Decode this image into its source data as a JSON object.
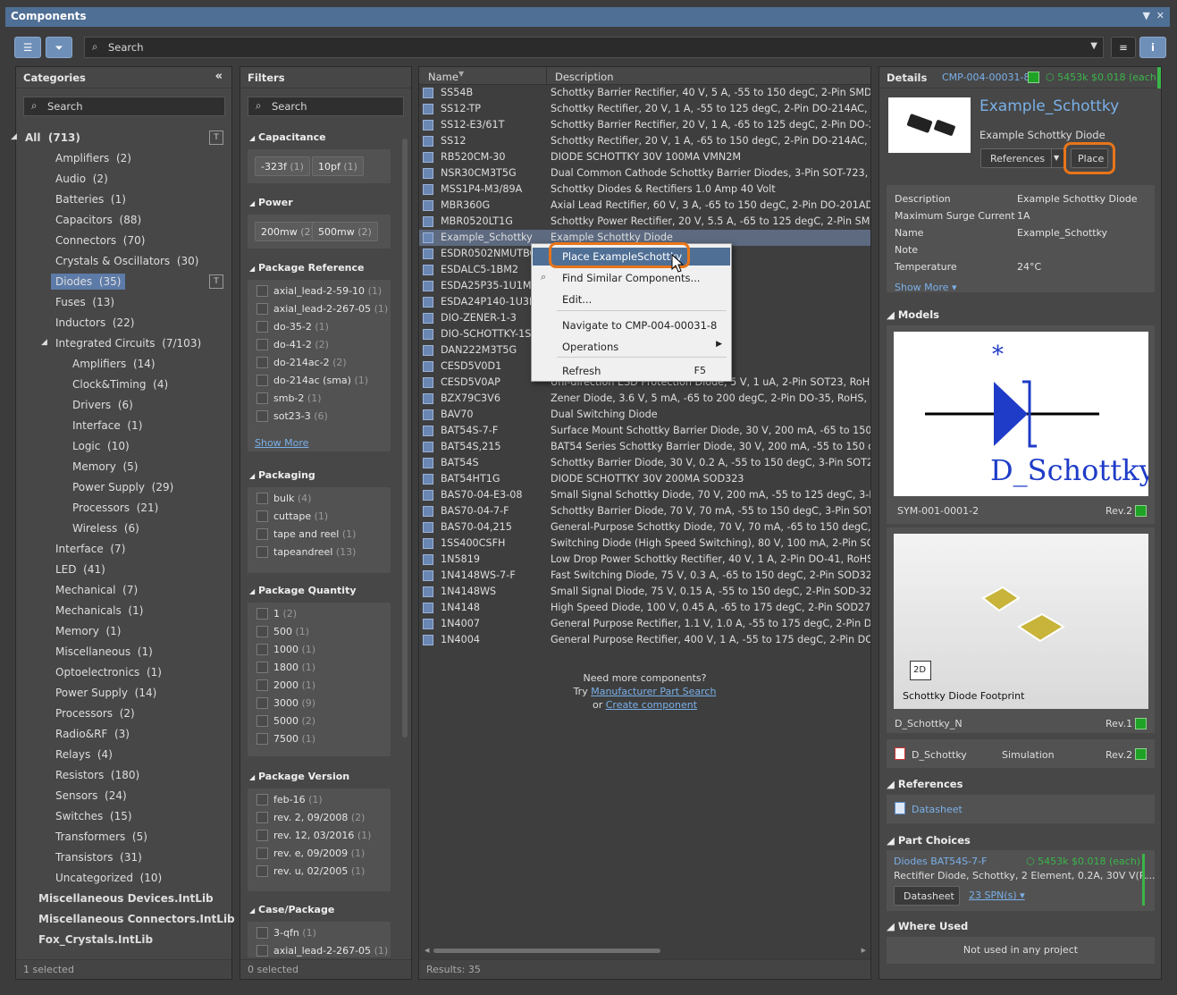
{
  "window": {
    "title": "Components"
  },
  "toolbar": {
    "search_placeholder": "Search"
  },
  "categories": {
    "header": "Categories",
    "search": "Search",
    "footer": "1 selected",
    "items": [
      {
        "label": "All",
        "count": "(713)",
        "level": 0,
        "expanded": true,
        "filter_icon": true
      },
      {
        "label": "Amplifiers",
        "count": "(2)",
        "level": 1
      },
      {
        "label": "Audio",
        "count": "(2)",
        "level": 1
      },
      {
        "label": "Batteries",
        "count": "(1)",
        "level": 1
      },
      {
        "label": "Capacitors",
        "count": "(88)",
        "level": 1
      },
      {
        "label": "Connectors",
        "count": "(70)",
        "level": 1
      },
      {
        "label": "Crystals & Oscillators",
        "count": "(30)",
        "level": 1
      },
      {
        "label": "Diodes",
        "count": "(35)",
        "level": 1,
        "selected": true,
        "filter_icon": true
      },
      {
        "label": "Fuses",
        "count": "(13)",
        "level": 1
      },
      {
        "label": "Inductors",
        "count": "(22)",
        "level": 1
      },
      {
        "label": "Integrated Circuits",
        "count": "(7/103)",
        "level": 1,
        "expanded": true
      },
      {
        "label": "Amplifiers",
        "count": "(14)",
        "level": 2
      },
      {
        "label": "Clock&Timing",
        "count": "(4)",
        "level": 2
      },
      {
        "label": "Drivers",
        "count": "(6)",
        "level": 2
      },
      {
        "label": "Interface",
        "count": "(1)",
        "level": 2
      },
      {
        "label": "Logic",
        "count": "(10)",
        "level": 2
      },
      {
        "label": "Memory",
        "count": "(5)",
        "level": 2
      },
      {
        "label": "Power Supply",
        "count": "(29)",
        "level": 2
      },
      {
        "label": "Processors",
        "count": "(21)",
        "level": 2
      },
      {
        "label": "Wireless",
        "count": "(6)",
        "level": 2
      },
      {
        "label": "Interface",
        "count": "(7)",
        "level": 1
      },
      {
        "label": "LED",
        "count": "(41)",
        "level": 1
      },
      {
        "label": "Mechanical",
        "count": "(7)",
        "level": 1
      },
      {
        "label": "Mechanicals",
        "count": "(1)",
        "level": 1
      },
      {
        "label": "Memory",
        "count": "(1)",
        "level": 1
      },
      {
        "label": "Miscellaneous",
        "count": "(1)",
        "level": 1
      },
      {
        "label": "Optoelectronics",
        "count": "(1)",
        "level": 1
      },
      {
        "label": "Power Supply",
        "count": "(14)",
        "level": 1
      },
      {
        "label": "Processors",
        "count": "(2)",
        "level": 1
      },
      {
        "label": "Radio&RF",
        "count": "(3)",
        "level": 1
      },
      {
        "label": "Relays",
        "count": "(4)",
        "level": 1
      },
      {
        "label": "Resistors",
        "count": "(180)",
        "level": 1
      },
      {
        "label": "Sensors",
        "count": "(24)",
        "level": 1
      },
      {
        "label": "Switches",
        "count": "(15)",
        "level": 1
      },
      {
        "label": "Transformers",
        "count": "(5)",
        "level": 1
      },
      {
        "label": "Transistors",
        "count": "(31)",
        "level": 1
      },
      {
        "label": "Uncategorized",
        "count": "(10)",
        "level": 1
      }
    ],
    "libs": [
      "Miscellaneous Devices.IntLib",
      "Miscellaneous Connectors.IntLib",
      "Fox_Crystals.IntLib"
    ]
  },
  "filters": {
    "header": "Filters",
    "search": "Search",
    "footer": "0 selected",
    "show_more": "Show More",
    "capacitance": {
      "title": "Capacitance",
      "chips": [
        {
          "label": "-323f",
          "count": "(1)"
        },
        {
          "label": "10pf",
          "count": "(1)"
        }
      ]
    },
    "power": {
      "title": "Power",
      "chips": [
        {
          "label": "200mw",
          "count": "(2)"
        },
        {
          "label": "500mw",
          "count": "(2)"
        }
      ]
    },
    "package_reference": {
      "title": "Package Reference",
      "items": [
        {
          "label": "axial_lead-2-59-10",
          "count": "(1)"
        },
        {
          "label": "axial_lead-2-267-05",
          "count": "(1)"
        },
        {
          "label": "do-35-2",
          "count": "(1)"
        },
        {
          "label": "do-41-2",
          "count": "(2)"
        },
        {
          "label": "do-214ac-2",
          "count": "(2)"
        },
        {
          "label": "do-214ac (sma)",
          "count": "(1)"
        },
        {
          "label": "smb-2",
          "count": "(1)"
        },
        {
          "label": "sot23-3",
          "count": "(6)"
        }
      ]
    },
    "packaging": {
      "title": "Packaging",
      "items": [
        {
          "label": "bulk",
          "count": "(4)"
        },
        {
          "label": "cuttape",
          "count": "(1)"
        },
        {
          "label": "tape and reel",
          "count": "(1)"
        },
        {
          "label": "tapeandreel",
          "count": "(13)"
        }
      ]
    },
    "package_quantity": {
      "title": "Package Quantity",
      "items": [
        {
          "label": "1",
          "count": "(2)"
        },
        {
          "label": "500",
          "count": "(1)"
        },
        {
          "label": "1000",
          "count": "(1)"
        },
        {
          "label": "1800",
          "count": "(1)"
        },
        {
          "label": "2000",
          "count": "(1)"
        },
        {
          "label": "3000",
          "count": "(9)"
        },
        {
          "label": "5000",
          "count": "(2)"
        },
        {
          "label": "7500",
          "count": "(1)"
        }
      ]
    },
    "package_version": {
      "title": "Package Version",
      "items": [
        {
          "label": "feb-16",
          "count": "(1)"
        },
        {
          "label": "rev. 2, 09/2008",
          "count": "(2)"
        },
        {
          "label": "rev. 12, 03/2016",
          "count": "(1)"
        },
        {
          "label": "rev. e, 09/2009",
          "count": "(1)"
        },
        {
          "label": "rev. u, 02/2005",
          "count": "(1)"
        }
      ]
    },
    "case_package": {
      "title": "Case/Package",
      "items": [
        {
          "label": "3-qfn",
          "count": "(1)"
        },
        {
          "label": "axial_lead-2-267-05",
          "count": "(1)"
        }
      ]
    }
  },
  "list": {
    "col_name": "Name",
    "col_desc": "Description",
    "footer": "Results: 35",
    "need_more": "Need more components?",
    "try": "Try",
    "mps": "Manufacturer Part Search",
    "or": "or",
    "create": "Create component",
    "rows": [
      [
        "SS54B",
        "Schottky Barrier Rectifier, 40 V, 5 A, -55 to 150 degC, 2-Pin SMD"
      ],
      [
        "SS12-TP",
        "Schottky Rectifier, 20 V, 1 A, -55 to 125 degC, 2-Pin DO-214AC, RoHS, T"
      ],
      [
        "SS12-E3/61T",
        "Schottky Barrier Rectifier, 20 V, 1 A, -65 to 125 degC, 2-Pin DO-214AC ("
      ],
      [
        "SS12",
        "Schottky Rectifier, 20 V, 1 A, -65 to 150 degC, 2-Pin DO-214AC, RoHS, T"
      ],
      [
        "RB520CM-30",
        "DIODE SCHOTTKY 30V 100MA VMN2M"
      ],
      [
        "NSR30CM3T5G",
        "Dual Common Cathode Schottky Barrier Diodes, 3-Pin SOT-723, Pb-Fre"
      ],
      [
        "MSS1P4-M3/89A",
        "Schottky Diodes & Rectifiers 1.0 Amp 40 Volt"
      ],
      [
        "MBR360G",
        "Axial Lead Rectifier, 60 V, 3 A, -65 to 150 degC, 2-Pin DO-201AD, RoHS,"
      ],
      [
        "MBR0520LT1G",
        "Schottky Power Rectifier, 20 V, 5.5 A, -65 to 125 degC, 2-Pin SMD, RoH"
      ],
      [
        "Example_Schottky",
        "Example Schottky Diode"
      ],
      [
        "ESDR0502NMUTBG",
        "                                        Array for High Speed Data Line"
      ],
      [
        "ESDALC5-1BM2",
        "                                          V, -55 to 150 degC, 2-Pin SOD"
      ],
      [
        "ESDA25P35-1U1M",
        ""
      ],
      [
        "ESDA24P140-1U3M",
        "                                          clamp"
      ],
      [
        "DIO-ZENER-1-3",
        ""
      ],
      [
        "DIO-SCHOTTKY-1S",
        ""
      ],
      [
        "DAN222M3T5G",
        "                                         ng Diodes, 3-Pin SOT-723, Pb-F"
      ],
      [
        "CESD5V0D1",
        "                                         1 uA, 2-Pin SOD-123, RoHS, T"
      ],
      [
        "CESD5V0AP",
        "Uni-direction ESD Protection Diode, 5 V, 1 uA, 2-Pin SOT23, RoHS, Ta"
      ],
      [
        "BZX79C3V6",
        "Zener Diode, 3.6 V, 5 mA, -65 to 200 degC, 2-Pin DO-35, RoHS, Bulk"
      ],
      [
        "BAV70",
        "Dual Switching Diode"
      ],
      [
        "BAT54S-7-F",
        "Surface Mount Schottky Barrier Diode, 30 V, 200 mA, -65 to 150 degC,"
      ],
      [
        "BAT54S,215",
        "BAT54 Series Schottky Barrier Diode, 30 V, 200 mA, -55 to 150 degC, 3-"
      ],
      [
        "BAT54S",
        "Schottky Barrier Diode, 30 V, 0.2 A, -55 to 150 degC, 3-Pin SOT23, RoH"
      ],
      [
        "BAT54HT1G",
        "DIODE SCHOTTKY 30V 200MA SOD323"
      ],
      [
        "BAS70-04-E3-08",
        "Small Signal Schottky Diode, 70 V, 200 mA, -55 to 125 degC, 3-Pin SOT"
      ],
      [
        "BAS70-04-7-F",
        "Schottky Barrier Diode, 70 V, 70 mA, -55 to 150 degC, 3-Pin SOT23, Ro"
      ],
      [
        "BAS70-04,215",
        "General-Purpose Schottky Diode, 70 V, 70 mA, -65 to 150 degC, 3-Pin S"
      ],
      [
        "1SS400CSFH",
        "Switching Diode (High Speed Switching), 80 V, 100 mA, 2-Pin SOD-923"
      ],
      [
        "1N5819",
        "Low Drop Power Schottky Rectifier, 40 V, 1 A, 2-Pin DO-41, RoHS"
      ],
      [
        "1N4148WS-7-F",
        "Fast Switching Diode, 75 V, 0.3 A, -65 to 150 degC, 2-Pin SOD323, RoH"
      ],
      [
        "1N4148WS",
        "Small Signal Diode, 75 V, 0.15 A, -55 to 150 degC, 2-Pin SOD-323, RoH"
      ],
      [
        "1N4148",
        "High Speed Diode, 100 V, 0.45 A, -65 to 175 degC, 2-Pin SOD27, RoHS,"
      ],
      [
        "1N4007",
        "General Purpose Rectifier, 1.1 V, 1.0 A, -55 to 175 degC, 2-Pin DO-41, F"
      ],
      [
        "1N4004",
        "General Purpose Rectifier, 400 V, 1 A, -55 to 175 degC, 2-Pin DO-204Al"
      ]
    ]
  },
  "context_menu": {
    "place": "Place ExampleSchottky",
    "find": "Find Similar Components...",
    "edit": "Edit...",
    "navigate": "Navigate to CMP-004-00031-8",
    "operations": "Operations",
    "refresh": "Refresh",
    "refresh_key": "F5"
  },
  "details": {
    "header": "Details",
    "id": "CMP-004-00031-8",
    "stock": "5453k",
    "price": "$0.018 (each)",
    "name": "Example_Schottky",
    "subtitle": "Example Schottky Diode",
    "references_btn": "References",
    "place_btn": "Place",
    "params": [
      [
        "Description",
        "Example Schottky Diode"
      ],
      [
        "Maximum Surge Current",
        "1A"
      ],
      [
        "Name",
        "Example_Schottky"
      ],
      [
        "Note",
        ""
      ],
      [
        "Temperature",
        "24°C"
      ]
    ],
    "show_more": "Show More",
    "models_title": "Models",
    "symbol_label": "D_Schottky",
    "symbol_id": "SYM-001-0001-2",
    "symbol_rev": "Rev.2",
    "footprint_badge": "2D",
    "footprint_caption": "Schottky Diode Footprint",
    "footprint_id": "D_Schottky_N",
    "footprint_rev": "Rev.1",
    "sim_name": "D_Schottky",
    "sim_type": "Simulation",
    "sim_rev": "Rev.2",
    "references_title": "References",
    "datasheet": "Datasheet",
    "part_choices_title": "Part Choices",
    "pc_name": "Diodes BAT54S-7-F",
    "pc_stock": "5453k",
    "pc_price": "$0.018 (each)",
    "pc_desc": "Rectifier Diode, Schottky, 2 Element, 0.2A, 30V V(R...",
    "pc_datasheet": "Datasheet",
    "pc_spn": "23 SPN(s)",
    "where_used_title": "Where Used",
    "where_used": "Not used in any project"
  }
}
